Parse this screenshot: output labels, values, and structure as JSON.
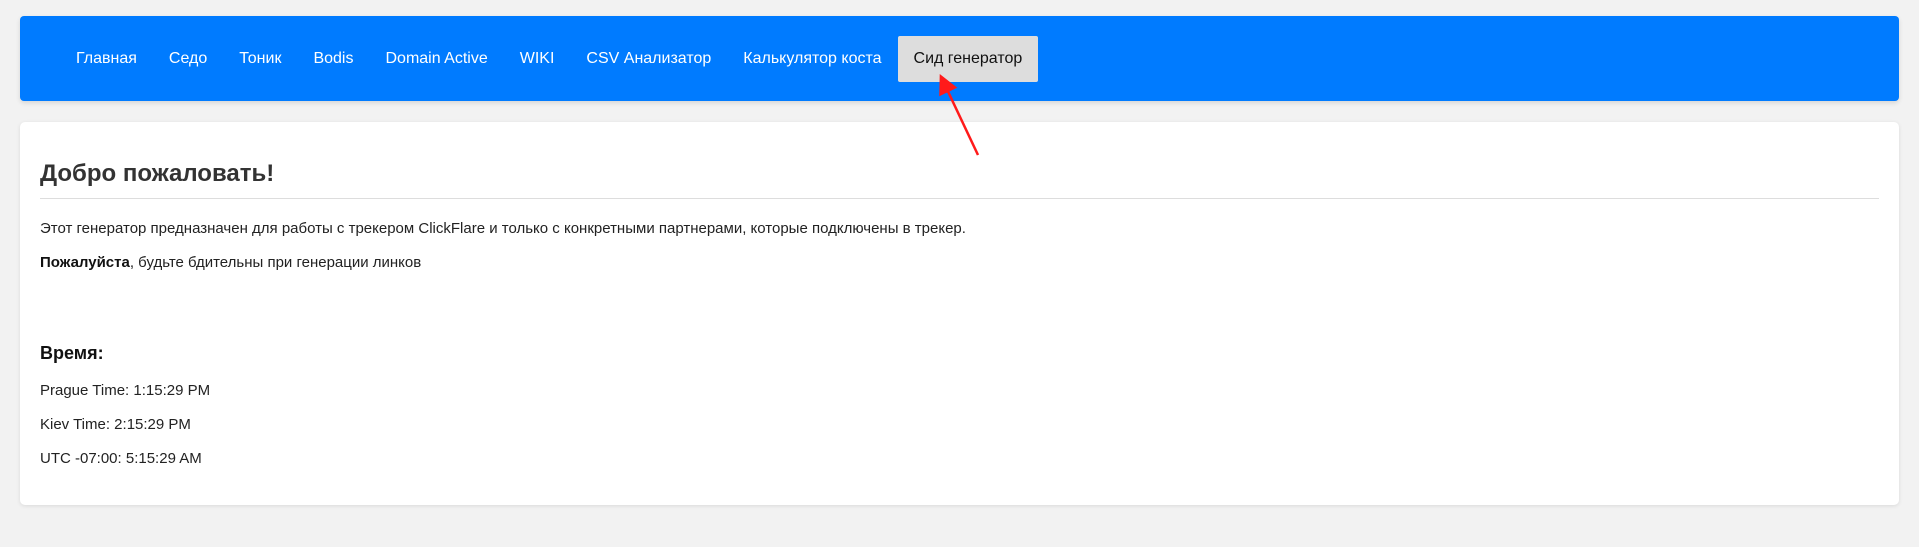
{
  "nav": {
    "items": [
      {
        "label": "Главная"
      },
      {
        "label": "Седо"
      },
      {
        "label": "Тоник"
      },
      {
        "label": "Bodis"
      },
      {
        "label": "Domain Active"
      },
      {
        "label": "WIKI"
      },
      {
        "label": "CSV Анализатор"
      },
      {
        "label": "Калькулятор коста"
      },
      {
        "label": "Сид генератор"
      }
    ],
    "active_index": 8
  },
  "content": {
    "title": "Добро пожаловать!",
    "description": "Этот генератор предназначен для работы с трекером ClickFlare и только с конкретными партнерами, которые подключены в трекер.",
    "warning_bold": "Пожалуйста",
    "warning_rest": ", будьте бдительны при генерации линков",
    "time_heading": "Время:",
    "times": [
      "Prague Time: 1:15:29 PM",
      "Kiev Time: 2:15:29 PM",
      "UTC -07:00: 5:15:29 AM"
    ]
  },
  "colors": {
    "navbar": "#007bff",
    "active_tab": "#dddddd",
    "annotation_arrow": "#ff1a1a"
  },
  "annotation": {
    "type": "arrow",
    "points_to": "nav-item-sid-generator"
  }
}
